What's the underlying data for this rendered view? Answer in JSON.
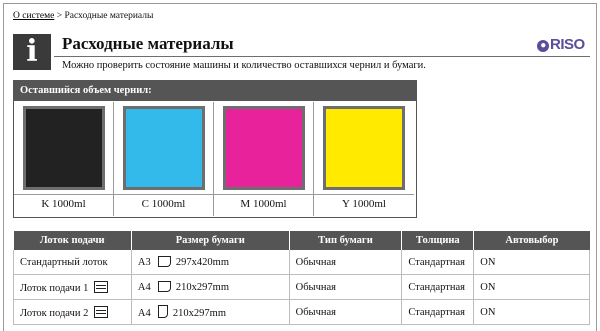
{
  "breadcrumb": {
    "parent": "О системе",
    "separator": " > ",
    "current": "Расходные материалы"
  },
  "header": {
    "title": "Расходные материалы",
    "subtitle": "Можно проверить состояние машины и количество оставшихся чернил и бумаги.",
    "logo": "RISO"
  },
  "ink": {
    "heading": "Оставшийся объем чернил:",
    "items": [
      {
        "label": "K 1000ml",
        "color": "#222222"
      },
      {
        "label": "C 1000ml",
        "color": "#34b9eb"
      },
      {
        "label": "M 1000ml",
        "color": "#e8229b"
      },
      {
        "label": "Y 1000ml",
        "color": "#ffea00"
      }
    ]
  },
  "trays": {
    "headers": [
      "Лоток подачи",
      "Размер бумаги",
      "Тип бумаги",
      "Толщина",
      "Автовыбор"
    ],
    "rows": [
      {
        "tray": "Стандартный лоток",
        "size_code": "A3",
        "size_dims": "297x420mm",
        "type": "Обычная",
        "thickness": "Стандартная",
        "auto": "ON"
      },
      {
        "tray": "Лоток подачи 1",
        "size_code": "A4",
        "size_dims": "210x297mm",
        "type": "Обычная",
        "thickness": "Стандартная",
        "auto": "ON"
      },
      {
        "tray": "Лоток подачи 2",
        "size_code": "A4",
        "size_dims": "210x297mm",
        "type": "Обычная",
        "thickness": "Стандартная",
        "auto": "ON"
      }
    ]
  }
}
